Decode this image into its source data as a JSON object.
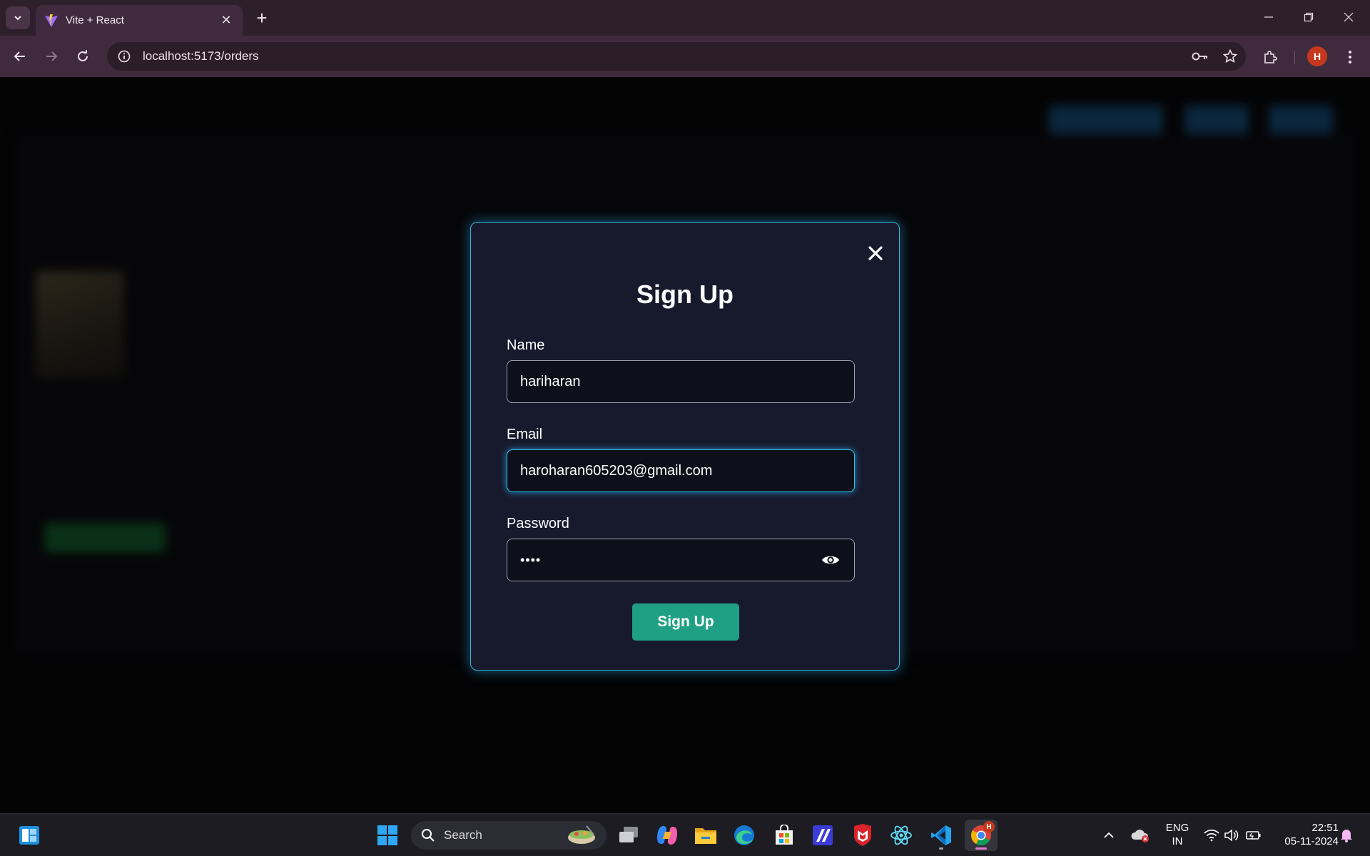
{
  "browser": {
    "tab_title": "Vite + React",
    "url": "localhost:5173/orders",
    "profile_initial": "H"
  },
  "modal": {
    "title": "Sign Up",
    "name_label": "Name",
    "name_value": "hariharan",
    "email_label": "Email",
    "email_value": "haroharan605203@gmail.com",
    "password_label": "Password",
    "password_mask": "••••",
    "submit_label": "Sign Up",
    "accent_color": "#2fb6d8",
    "button_color": "#1fa085"
  },
  "taskbar": {
    "search_placeholder": "Search",
    "lang_line1": "ENG",
    "lang_line2": "IN",
    "time": "22:51",
    "date": "05-11-2024",
    "chrome_badge": "H"
  }
}
